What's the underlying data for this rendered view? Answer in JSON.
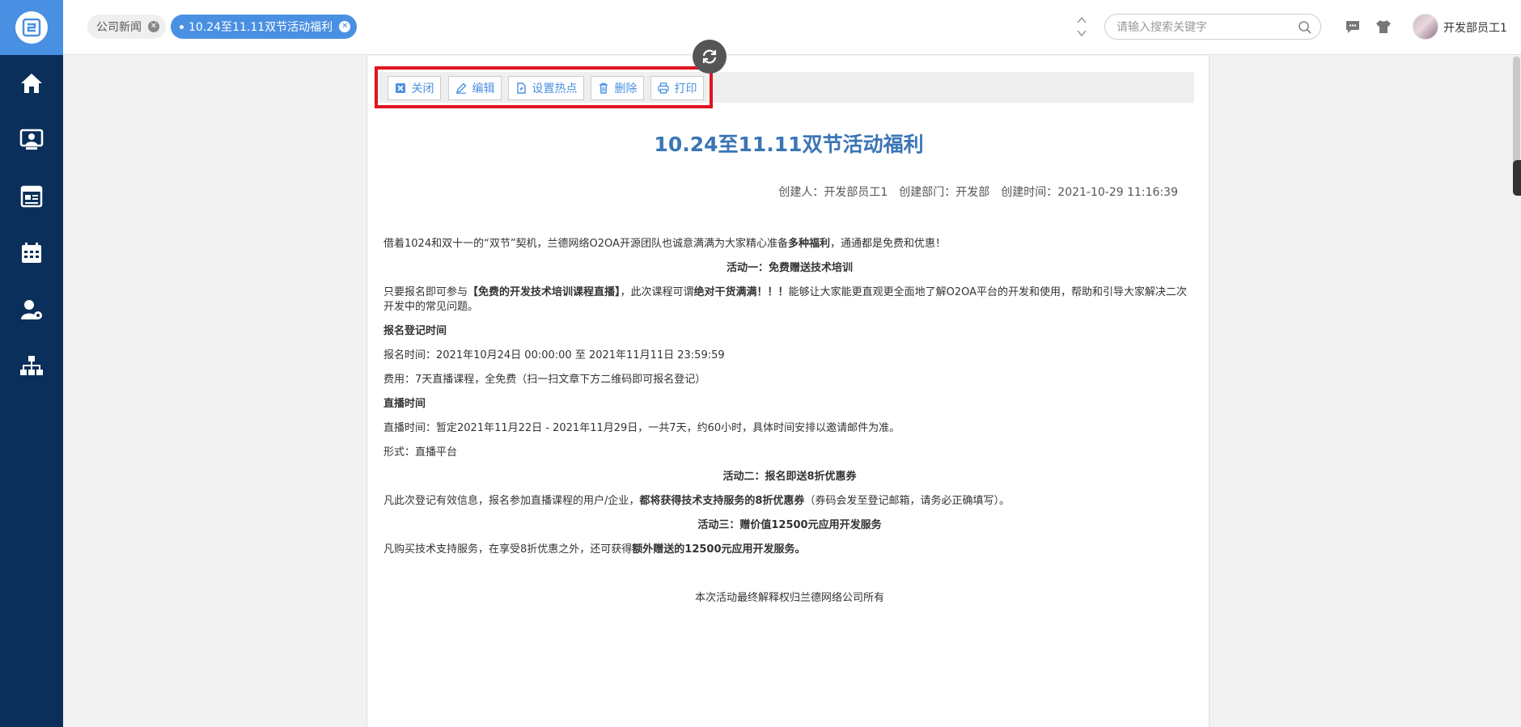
{
  "sidebar": {
    "logo": "app-logo-icon",
    "items": [
      {
        "name": "home",
        "icon": "home-icon"
      },
      {
        "name": "contacts",
        "icon": "person-screen-icon"
      },
      {
        "name": "news",
        "icon": "news-icon"
      },
      {
        "name": "calendar",
        "icon": "calendar-icon"
      },
      {
        "name": "user-settings",
        "icon": "user-gear-icon"
      },
      {
        "name": "org-chart",
        "icon": "org-chart-icon"
      }
    ],
    "bg_color": "#0b2f5b",
    "logo_bg_color": "#4a90e2"
  },
  "header": {
    "tabs": [
      {
        "label": "公司新闻",
        "active": false
      },
      {
        "label": "10.24至11.11双节活动福利",
        "active": true
      }
    ],
    "search": {
      "placeholder": "请输入搜索关键字",
      "value": ""
    },
    "icons": [
      "chat-icon",
      "shirt-icon"
    ],
    "user_name": "开发部员工1",
    "accent_color": "#4a90e2"
  },
  "toolbar": {
    "buttons": [
      {
        "label": "关闭",
        "icon": "close-icon"
      },
      {
        "label": "编辑",
        "icon": "edit-icon"
      },
      {
        "label": "设置热点",
        "icon": "document-icon"
      },
      {
        "label": "删除",
        "icon": "trash-icon"
      },
      {
        "label": "打印",
        "icon": "print-icon"
      }
    ],
    "highlight_color": "#e0141e"
  },
  "document": {
    "title": "10.24至11.11双节活动福利",
    "meta": {
      "creator_label": "创建人：",
      "creator": "开发部员工1",
      "dept_label": "创建部门：",
      "dept": "开发部",
      "time_label": "创建时间：",
      "time": "2021-10-29 11:16:39"
    },
    "intro": {
      "a": "借着1024和双十一的“双节”契机，兰德网络O2OA开源团队也诚意满满为大家精心准备",
      "b": "多种福利",
      "c": "，通通都是免费和优惠！"
    },
    "activity1_heading": "活动一：免费赠送技术培训",
    "activity1_text": {
      "a": "只要报名即可参与",
      "b": "【免费的开发技术培训课程直播】",
      "c": "，此次课程可谓",
      "d": "绝对干货满满！！！",
      "e": "能够让大家能更直观更全面地了解O2OA平台的开发和使用，帮助和引导大家解决二次开发中的常见问题。"
    },
    "reg_heading": "报名登记时间",
    "reg_time": "报名时间：2021年10月24日 00:00:00  至 2021年11月11日 23:59:59",
    "fee": "费用：7天直播课程，全免费（扫一扫文章下方二维码即可报名登记）",
    "live_heading": "直播时间",
    "live_time": "直播时间：暂定2021年11月22日 - 2021年11月29日，一共7天，约60小时，具体时间安排以邀请邮件为准。",
    "format": "形式：直播平台",
    "activity2_heading": "活动二：报名即送8折优惠券",
    "activity2_text": {
      "a": "凡此次登记有效信息，报名参加直播课程的用户/企业，",
      "b": "都将获得技术支持服务的8折优惠券",
      "c": "（券码会发至登记邮箱，请务必正确填写）。"
    },
    "activity3_heading": "活动三：赠价值12500元应用开发服务",
    "activity3_text": {
      "a": "凡购买技术支持服务，在享受8折优惠之外，还可获得",
      "b": "额外赠送的12500元应用开发服务。"
    },
    "footer_note": "本次活动最终解释权归兰德网络公司所有",
    "title_color": "#3a75b6"
  }
}
